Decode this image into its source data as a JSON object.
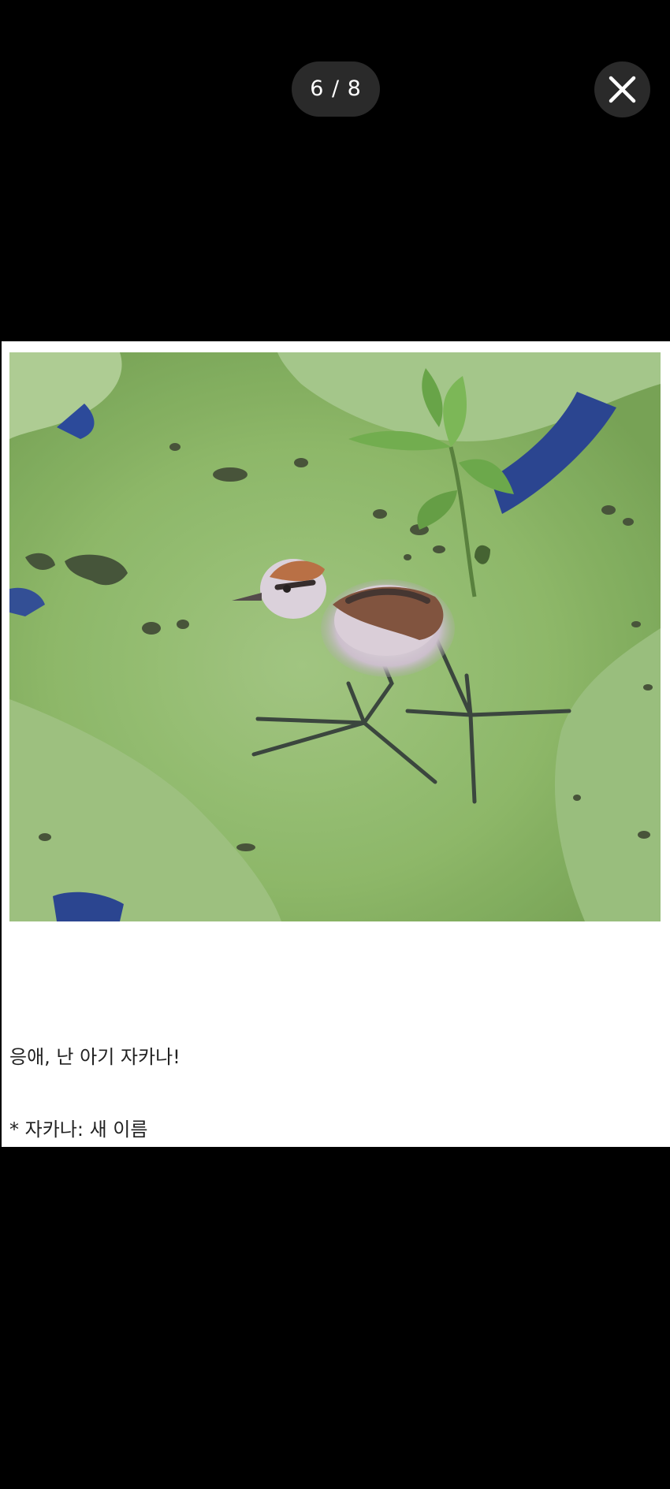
{
  "viewer": {
    "page_counter": "6 / 8",
    "close_icon": "close-icon"
  },
  "content": {
    "photo_subject": "baby jacana chick on lily pad",
    "caption_main": "응애, 난 아기 자카나!",
    "caption_note": "* 자카나: 새 이름"
  },
  "colors": {
    "background": "#000000",
    "pill": "#2a2a2a",
    "card": "#ffffff",
    "lily_pad": "#8db86a",
    "water": "#1e3a8a"
  }
}
